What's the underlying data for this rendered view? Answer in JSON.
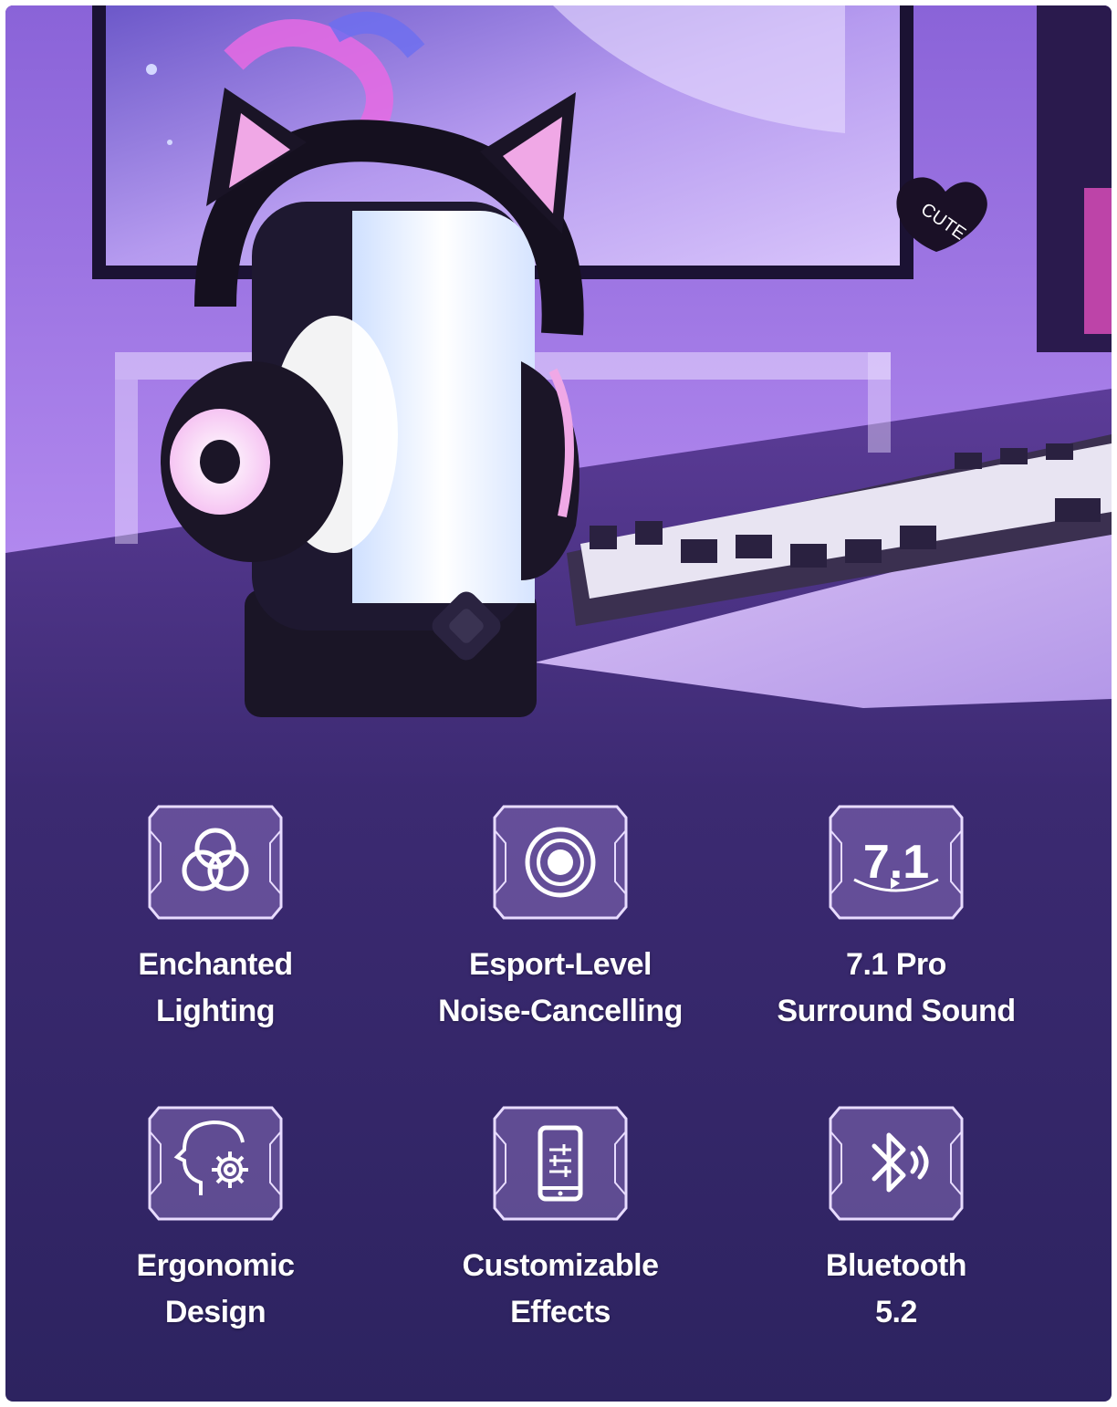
{
  "hero": {
    "sticker_text": "CUTE"
  },
  "features": [
    {
      "icon": "rgb-circles-icon",
      "line1": "Enchanted",
      "line2": "Lighting"
    },
    {
      "icon": "noise-cancel-target-icon",
      "line1": "Esport-Level",
      "line2": "Noise-Cancelling"
    },
    {
      "icon": "surround-7-1-icon",
      "icon_text": "7.1",
      "line1": "7.1 Pro",
      "line2": "Surround Sound"
    },
    {
      "icon": "head-gear-icon",
      "line1": "Ergonomic",
      "line2": "Design"
    },
    {
      "icon": "phone-equalizer-icon",
      "line1": "Customizable",
      "line2": "Effects"
    },
    {
      "icon": "bluetooth-icon",
      "line1": "Bluetooth",
      "line2": "5.2"
    }
  ],
  "colors": {
    "background_top": "#4a2f83",
    "background_bottom": "#2d2360",
    "accent_pink": "#f0a8e6",
    "text": "#ffffff"
  }
}
